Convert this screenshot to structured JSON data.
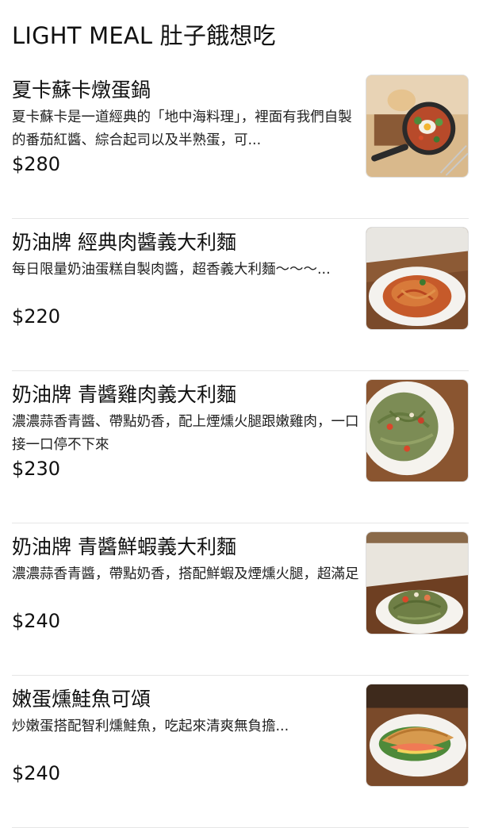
{
  "header": {
    "title": "LIGHT MEAL 肚子餓想吃"
  },
  "items": [
    {
      "name": "夏卡蘇卡燉蛋鍋",
      "desc": "夏卡蘇卡是一道經典的「地中海料理」，裡面有我們自製的番茄紅醬、綜合起司以及半熟蛋，可...",
      "price": "$280",
      "image": "shakshuka-photo"
    },
    {
      "name": "奶油牌 經典肉醬義大利麵",
      "desc": "每日限量奶油蛋糕自製肉醬，超香義大利麵～～～...",
      "price": "$220",
      "image": "bolognese-pasta-photo"
    },
    {
      "name": "奶油牌 青醬雞肉義大利麵",
      "desc": "濃濃蒜香青醬、帶點奶香，配上煙燻火腿跟嫩雞肉，一口接一口停不下來",
      "price": "$230",
      "image": "pesto-chicken-pasta-photo"
    },
    {
      "name": "奶油牌 青醬鮮蝦義大利麵",
      "desc": "濃濃蒜香青醬，帶點奶香，搭配鮮蝦及煙燻火腿，超滿足",
      "price": "$240",
      "image": "pesto-shrimp-pasta-photo"
    },
    {
      "name": "嫩蛋燻鮭魚可頌",
      "desc": "炒嫩蛋搭配智利燻鮭魚，吃起來清爽無負擔...",
      "price": "$240",
      "image": "salmon-croissant-photo"
    }
  ]
}
